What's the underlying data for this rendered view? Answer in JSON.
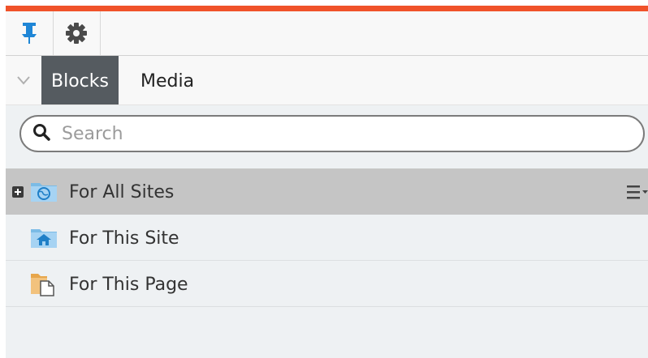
{
  "colors": {
    "accent": "#f0522a",
    "pin": "#1f86d6",
    "active_tab": "#555b60",
    "selected_row": "#c5c5c5"
  },
  "toolbar": {
    "pin_icon": "pin-icon",
    "settings_icon": "gear-icon"
  },
  "tabs": {
    "collapse_icon": "chevron-down-icon",
    "items": [
      {
        "label": "Blocks",
        "active": true
      },
      {
        "label": "Media",
        "active": false
      }
    ]
  },
  "search": {
    "placeholder": "Search",
    "value": ""
  },
  "tree": {
    "items": [
      {
        "label": "For All Sites",
        "icon": "globe-folder-icon",
        "expandable": true,
        "selected": true
      },
      {
        "label": "For This Site",
        "icon": "home-folder-icon",
        "expandable": false,
        "selected": false
      },
      {
        "label": "For This Page",
        "icon": "page-folder-icon",
        "expandable": false,
        "selected": false
      }
    ]
  }
}
